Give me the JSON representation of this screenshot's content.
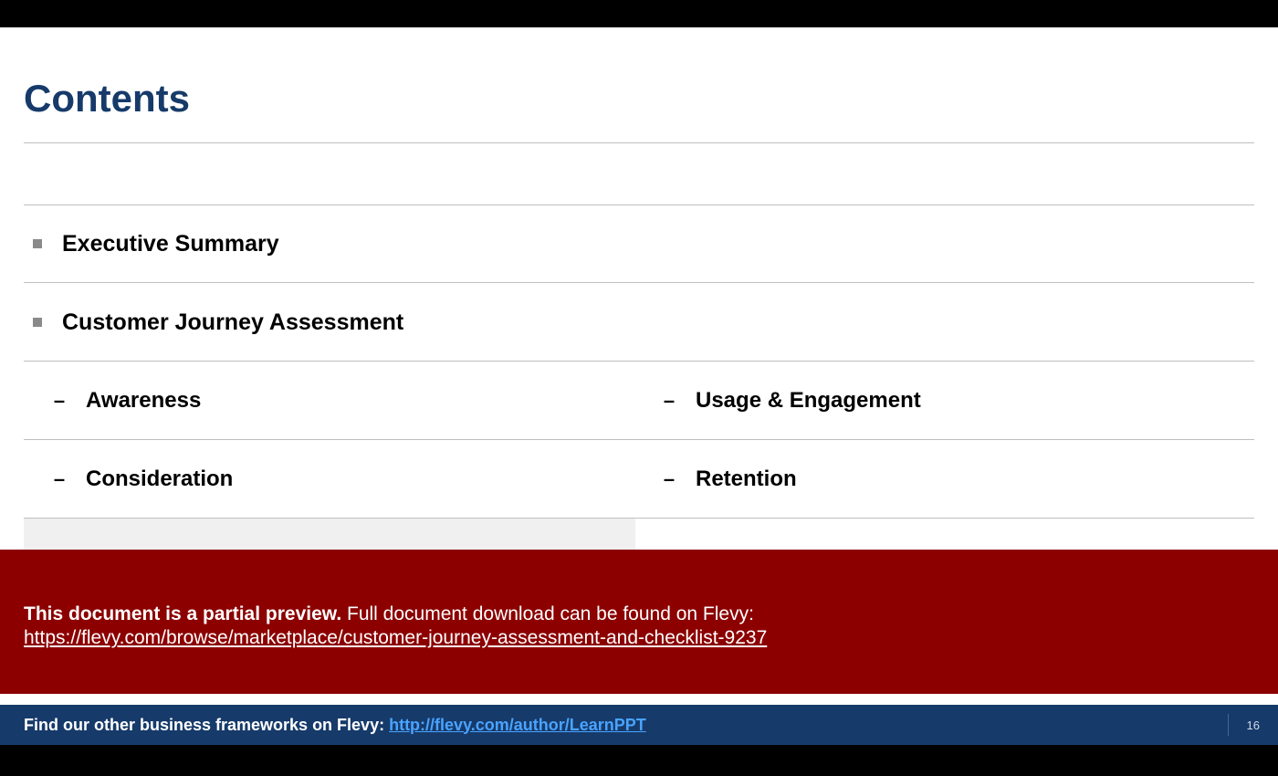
{
  "title": "Contents",
  "main_items": {
    "exec": "Executive Summary",
    "cja": "Customer Journey Assessment"
  },
  "sub_left": {
    "awareness": "Awareness",
    "consideration": "Consideration"
  },
  "sub_right": {
    "usage": "Usage & Engagement",
    "retention": "Retention"
  },
  "banner": {
    "bold": "This document is a partial preview.",
    "rest": "  Full document download can be found on Flevy:",
    "link": "https://flevy.com/browse/marketplace/customer-journey-assessment-and-checklist-9237"
  },
  "footer": {
    "text": "Find our other business frameworks on Flevy: ",
    "link": "http://flevy.com/author/LearnPPT",
    "page": "16"
  },
  "glyphs": {
    "dash": "–"
  }
}
